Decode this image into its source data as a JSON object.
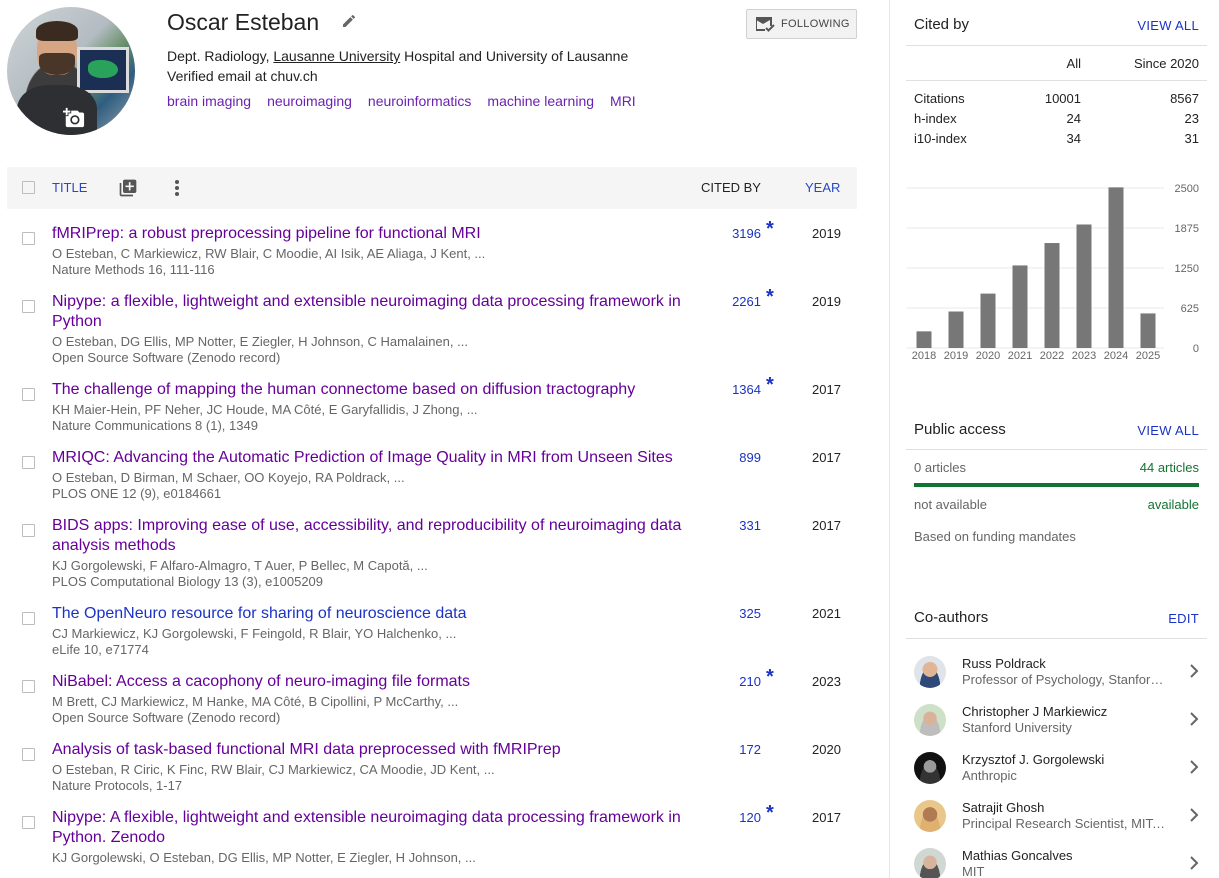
{
  "profile": {
    "name": "Oscar Esteban",
    "affiliation_pre": "Dept. Radiology, ",
    "affiliation_link": "Lausanne University",
    "affiliation_post": " Hospital and University of Lausanne",
    "email": "Verified email at chuv.ch",
    "interests": [
      "brain imaging",
      "neuroimaging",
      "neuroinformatics",
      "machine learning",
      "MRI"
    ],
    "follow_label": "FOLLOWING"
  },
  "table": {
    "title_label": "TITLE",
    "cited_label": "CITED BY",
    "year_label": "YEAR"
  },
  "articles": [
    {
      "title": "fMRIPrep: a robust preprocessing pipeline for functional MRI",
      "authors": "O Esteban, C Markiewicz, RW Blair, C Moodie, AI Isik, AE Aliaga, J Kent, ...",
      "venue": "Nature Methods 16, 111-116",
      "cited": "3196",
      "star": "*",
      "year": "2019",
      "visited": true
    },
    {
      "title": "Nipype: a flexible, lightweight and extensible neuroimaging data processing framework in Python",
      "authors": "O Esteban, DG Ellis, MP Notter, E Ziegler, H Johnson, C Hamalainen, ...",
      "venue": "Open Source Software (Zenodo record)",
      "cited": "2261",
      "star": "*",
      "year": "2019",
      "visited": true
    },
    {
      "title": "The challenge of mapping the human connectome based on diffusion tractography",
      "authors": "KH Maier-Hein, PF Neher, JC Houde, MA Côté, E Garyfallidis, J Zhong, ...",
      "venue": "Nature Communications 8 (1), 1349",
      "cited": "1364",
      "star": "*",
      "year": "2017",
      "visited": true
    },
    {
      "title": "MRIQC: Advancing the Automatic Prediction of Image Quality in MRI from Unseen Sites",
      "authors": "O Esteban, D Birman, M Schaer, OO Koyejo, RA Poldrack, ...",
      "venue": "PLOS ONE 12 (9), e0184661",
      "cited": "899",
      "star": "",
      "year": "2017",
      "visited": true
    },
    {
      "title": "BIDS apps: Improving ease of use, accessibility, and reproducibility of neuroimaging data analysis methods",
      "authors": "KJ Gorgolewski, F Alfaro-Almagro, T Auer, P Bellec, M Capotă, ...",
      "venue": "PLOS Computational Biology 13 (3), e1005209",
      "cited": "331",
      "star": "",
      "year": "2017",
      "visited": true
    },
    {
      "title": "The OpenNeuro resource for sharing of neuroscience data",
      "authors": "CJ Markiewicz, KJ Gorgolewski, F Feingold, R Blair, YO Halchenko, ...",
      "venue": "eLife 10, e71774",
      "cited": "325",
      "star": "",
      "year": "2021",
      "visited": false
    },
    {
      "title": "NiBabel: Access a cacophony of neuro-imaging file formats",
      "authors": "M Brett, CJ Markiewicz, M Hanke, MA Côté, B Cipollini, P McCarthy, ...",
      "venue": "Open Source Software (Zenodo record)",
      "cited": "210",
      "star": "*",
      "year": "2023",
      "visited": true
    },
    {
      "title": "Analysis of task-based functional MRI data preprocessed with fMRIPrep",
      "authors": "O Esteban, R Ciric, K Finc, RW Blair, CJ Markiewicz, CA Moodie, JD Kent, ...",
      "venue": "Nature Protocols, 1-17",
      "cited": "172",
      "star": "",
      "year": "2020",
      "visited": true
    },
    {
      "title": "Nipype: A flexible, lightweight and extensible neuroimaging data processing framework in Python. Zenodo",
      "authors": "KJ Gorgolewski, O Esteban, DG Ellis, MP Notter, E Ziegler, H Johnson, ...",
      "venue": "",
      "cited": "120",
      "star": "*",
      "year": "2017",
      "visited": true
    }
  ],
  "cited_by": {
    "title": "Cited by",
    "view_all": "VIEW ALL",
    "col_all": "All",
    "col_since": "Since 2020",
    "rows": [
      {
        "label": "Citations",
        "all": "10001",
        "since": "8567"
      },
      {
        "label": "h-index",
        "all": "24",
        "since": "23"
      },
      {
        "label": "i10-index",
        "all": "34",
        "since": "31"
      }
    ]
  },
  "chart_data": {
    "type": "bar",
    "categories": [
      "2018",
      "2019",
      "2020",
      "2021",
      "2022",
      "2023",
      "2024",
      "2025"
    ],
    "values": [
      260,
      570,
      850,
      1290,
      1640,
      1930,
      2510,
      540
    ],
    "ylim": [
      0,
      2500
    ],
    "yticks": [
      "0",
      "625",
      "1250",
      "1875",
      "2500"
    ],
    "bar_color": "#777777"
  },
  "public_access": {
    "title": "Public access",
    "view_all": "VIEW ALL",
    "left_count": "0 articles",
    "right_count": "44 articles",
    "left_label": "not available",
    "right_label": "available",
    "note": "Based on funding mandates",
    "accent": "#137333"
  },
  "coauthors": {
    "title": "Co-authors",
    "edit": "EDIT",
    "items": [
      {
        "name": "Russ Poldrack",
        "affil": "Professor of Psychology, Stanford University"
      },
      {
        "name": "Christopher J Markiewicz",
        "affil": "Stanford University"
      },
      {
        "name": "Krzysztof J. Gorgolewski",
        "affil": "Anthropic"
      },
      {
        "name": "Satrajit Ghosh",
        "affil": "Principal Research Scientist, MIT, Harvard"
      },
      {
        "name": "Mathias Goncalves",
        "affil": "MIT"
      }
    ]
  }
}
